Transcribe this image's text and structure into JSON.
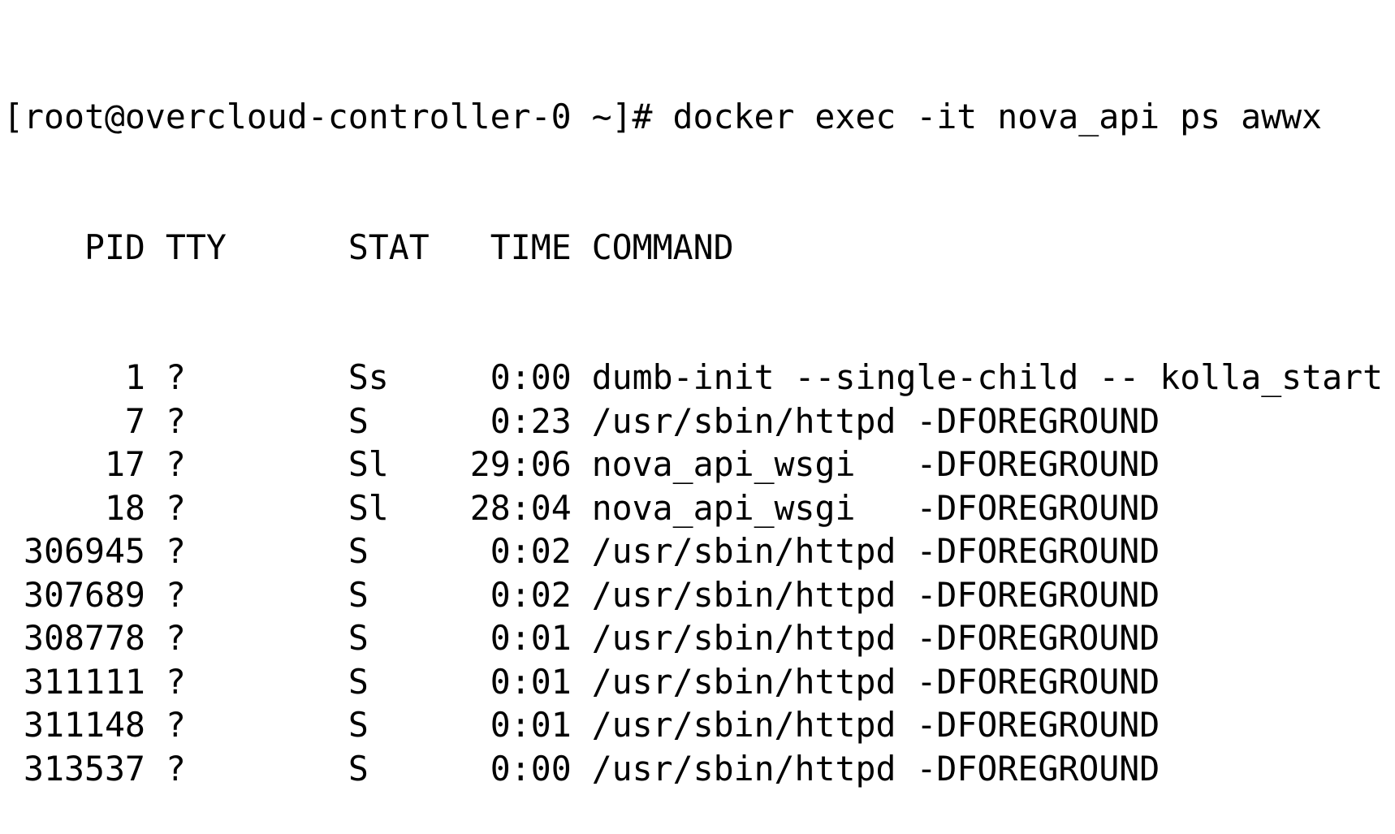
{
  "terminal": {
    "prompt": "[root@overcloud-controller-0 ~]# ",
    "command": "docker exec -it nova_api ps awwx",
    "headers": [
      "PID",
      "TTY",
      "STAT",
      "TIME",
      "COMMAND"
    ],
    "rows": [
      [
        "1",
        "?",
        "Ss",
        "0:00",
        "dumb-init --single-child -- kolla_start"
      ],
      [
        "7",
        "?",
        "S",
        "0:23",
        "/usr/sbin/httpd -DFOREGROUND"
      ],
      [
        "17",
        "?",
        "Sl",
        "29:06",
        "nova_api_wsgi   -DFOREGROUND"
      ],
      [
        "18",
        "?",
        "Sl",
        "28:04",
        "nova_api_wsgi   -DFOREGROUND"
      ],
      [
        "306945",
        "?",
        "S",
        "0:02",
        "/usr/sbin/httpd -DFOREGROUND"
      ],
      [
        "307689",
        "?",
        "S",
        "0:02",
        "/usr/sbin/httpd -DFOREGROUND"
      ],
      [
        "308778",
        "?",
        "S",
        "0:01",
        "/usr/sbin/httpd -DFOREGROUND"
      ],
      [
        "311111",
        "?",
        "S",
        "0:01",
        "/usr/sbin/httpd -DFOREGROUND"
      ],
      [
        "311148",
        "?",
        "S",
        "0:01",
        "/usr/sbin/httpd -DFOREGROUND"
      ],
      [
        "313537",
        "?",
        "S",
        "0:00",
        "/usr/sbin/httpd -DFOREGROUND"
      ]
    ]
  }
}
